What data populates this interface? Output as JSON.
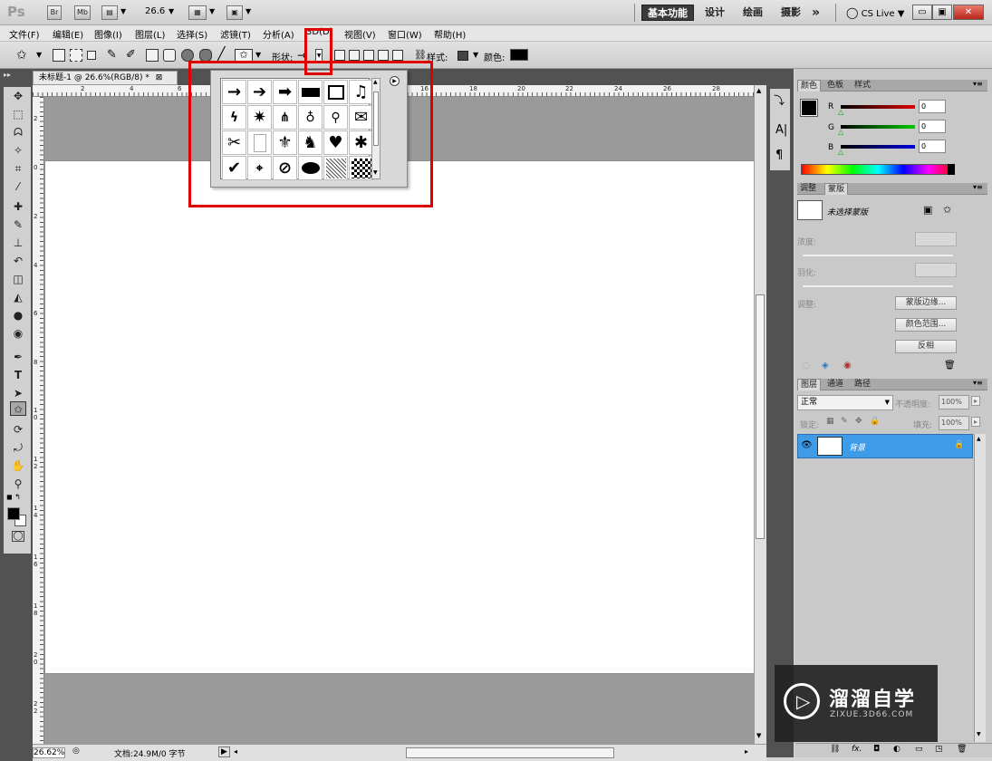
{
  "app": {
    "logo": "Ps",
    "bridge_btn": "Br",
    "minibridge_btn": "Mb",
    "zoom": "26.6",
    "workspaces": [
      "基本功能",
      "设计",
      "绘画",
      "摄影"
    ],
    "more": "»",
    "cs_live": "CS Live"
  },
  "menu": [
    "文件(F)",
    "编辑(E)",
    "图像(I)",
    "图层(L)",
    "选择(S)",
    "滤镜(T)",
    "分析(A)",
    "3D(D)",
    "视图(V)",
    "窗口(W)",
    "帮助(H)"
  ],
  "options": {
    "shape_label": "形状:",
    "style_label": "样式:",
    "color_label": "颜色:",
    "color_value": "#000000"
  },
  "document": {
    "tab_title": "未标题-1 @ 26.6%(RGB/8) *",
    "ruler_h": [
      "2",
      "4",
      "6",
      "16",
      "18",
      "20",
      "22",
      "24",
      "26",
      "28"
    ],
    "ruler_v": [
      "2",
      "0",
      "2",
      "4",
      "6",
      "8",
      "10",
      "12",
      "14",
      "16",
      "18",
      "20",
      "22"
    ],
    "status_zoom": "26.62%",
    "status_doc": "文档:24.9M/0 字节"
  },
  "shape_picker": {
    "shapes": [
      "arrow-thin",
      "arrow-medium",
      "arrow-bold",
      "banner",
      "frame",
      "music-note",
      "lightning",
      "starburst",
      "grass",
      "lightbulb",
      "pushpin",
      "envelope",
      "scissors",
      "blank-page",
      "fleur-de-lis",
      "cat",
      "heart",
      "puzzle",
      "checkmark",
      "target",
      "no-sign",
      "speech-bubble",
      "hatch",
      "checker"
    ]
  },
  "color_panel": {
    "tabs": [
      "颜色",
      "色板",
      "样式"
    ],
    "channels": [
      {
        "name": "R",
        "value": "0"
      },
      {
        "name": "G",
        "value": "0"
      },
      {
        "name": "B",
        "value": "0"
      }
    ]
  },
  "mask_panel": {
    "tabs": [
      "调整",
      "蒙版"
    ],
    "no_mask": "未选择蒙版",
    "density": "浓度:",
    "feather": "羽化:",
    "refine": "调整:",
    "btn_edge": "蒙版边缘...",
    "btn_range": "颜色范围...",
    "btn_invert": "反相"
  },
  "layers_panel": {
    "tabs": [
      "图层",
      "通道",
      "路径"
    ],
    "blend_mode": "正常",
    "opacity_label": "不透明度:",
    "opacity": "100%",
    "lock_label": "锁定:",
    "fill_label": "填充:",
    "fill": "100%",
    "layer_name": "背景"
  },
  "watermark": {
    "brand": "溜溜自学",
    "url": "ZIXUE.3D66.COM"
  }
}
